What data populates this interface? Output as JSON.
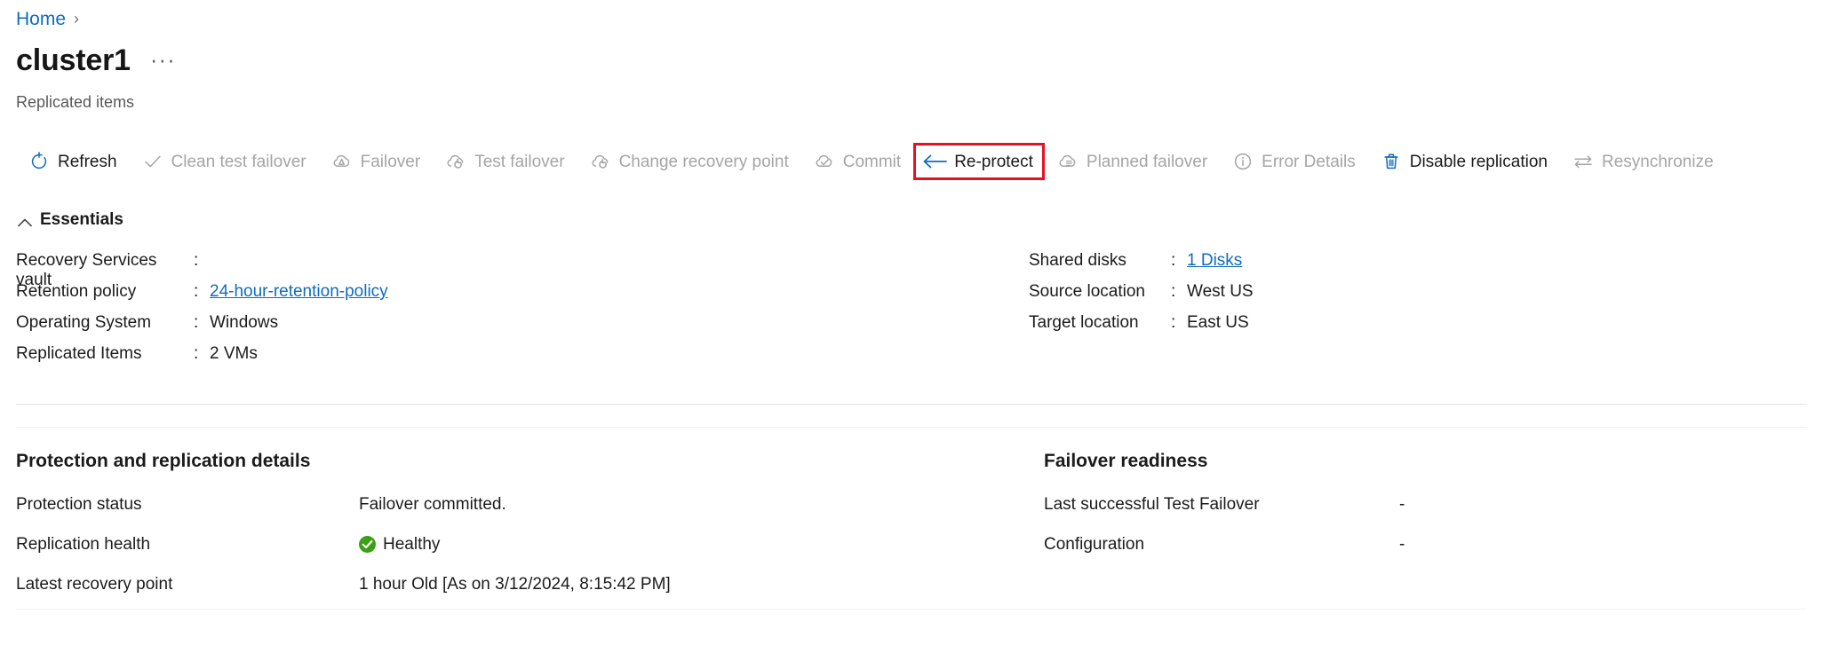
{
  "breadcrumb": {
    "home_label": "Home",
    "separator": "›"
  },
  "header": {
    "title": "cluster1",
    "ellipsis": "···",
    "subtitle": "Replicated items"
  },
  "colors": {
    "link": "#0f6cbd",
    "highlight_border": "#e81123",
    "icon_blue": "#0f6cbd",
    "disabled_text": "#a5a5a5",
    "healthy_green": "#3aa017"
  },
  "commandbar": {
    "items": [
      {
        "label": "Refresh",
        "icon": "refresh-icon",
        "enabled": true,
        "highlighted": false
      },
      {
        "label": "Clean test failover",
        "icon": "checkmark-icon",
        "enabled": false,
        "highlighted": false
      },
      {
        "label": "Failover",
        "icon": "cloud-failover-icon",
        "enabled": false,
        "highlighted": false
      },
      {
        "label": "Test failover",
        "icon": "cloud-refresh-icon",
        "enabled": false,
        "highlighted": false
      },
      {
        "label": "Change recovery point",
        "icon": "cloud-refresh-icon",
        "enabled": false,
        "highlighted": false
      },
      {
        "label": "Commit",
        "icon": "cloud-check-icon",
        "enabled": false,
        "highlighted": false
      },
      {
        "label": "Re-protect",
        "icon": "arrow-left-icon",
        "enabled": true,
        "highlighted": true
      },
      {
        "label": "Planned failover",
        "icon": "cloud-planned-icon",
        "enabled": false,
        "highlighted": false
      },
      {
        "label": "Error Details",
        "icon": "info-icon",
        "enabled": false,
        "highlighted": false
      },
      {
        "label": "Disable replication",
        "icon": "trash-icon",
        "enabled": true,
        "highlighted": false
      },
      {
        "label": "Resynchronize",
        "icon": "sync-arrows-icon",
        "enabled": false,
        "highlighted": false
      }
    ]
  },
  "essentials": {
    "header_label": "Essentials",
    "chevron_icon": "chevron-up-icon",
    "left": [
      {
        "key": "Recovery Services vault",
        "colon": ":",
        "value": "",
        "is_link": false
      },
      {
        "key": "Retention policy",
        "colon": ":",
        "value": "24-hour-retention-policy",
        "is_link": true
      },
      {
        "key": "Operating System",
        "colon": ":",
        "value": "Windows",
        "is_link": false
      },
      {
        "key": "Replicated Items",
        "colon": ":",
        "value": "2 VMs",
        "is_link": false
      }
    ],
    "right": [
      {
        "key": "Shared disks",
        "colon": ":",
        "value": "1 Disks",
        "is_link": true
      },
      {
        "key": "Source location",
        "colon": ":",
        "value": "West US",
        "is_link": false
      },
      {
        "key": "Target location",
        "colon": ":",
        "value": "East US",
        "is_link": false
      }
    ]
  },
  "protection_section": {
    "title": "Protection and replication details",
    "rows": [
      {
        "key": "Protection status",
        "value": "Failover committed.",
        "icon": ""
      },
      {
        "key": "Replication health",
        "value": "Healthy",
        "icon": "health-check-icon"
      },
      {
        "key": "Latest recovery point",
        "value": "1 hour Old [As on 3/12/2024, 8:15:42 PM]",
        "icon": ""
      }
    ]
  },
  "failover_section": {
    "title": "Failover readiness",
    "rows": [
      {
        "key": "Last successful Test Failover",
        "value": "-"
      },
      {
        "key": "Configuration",
        "value": "-"
      }
    ]
  }
}
